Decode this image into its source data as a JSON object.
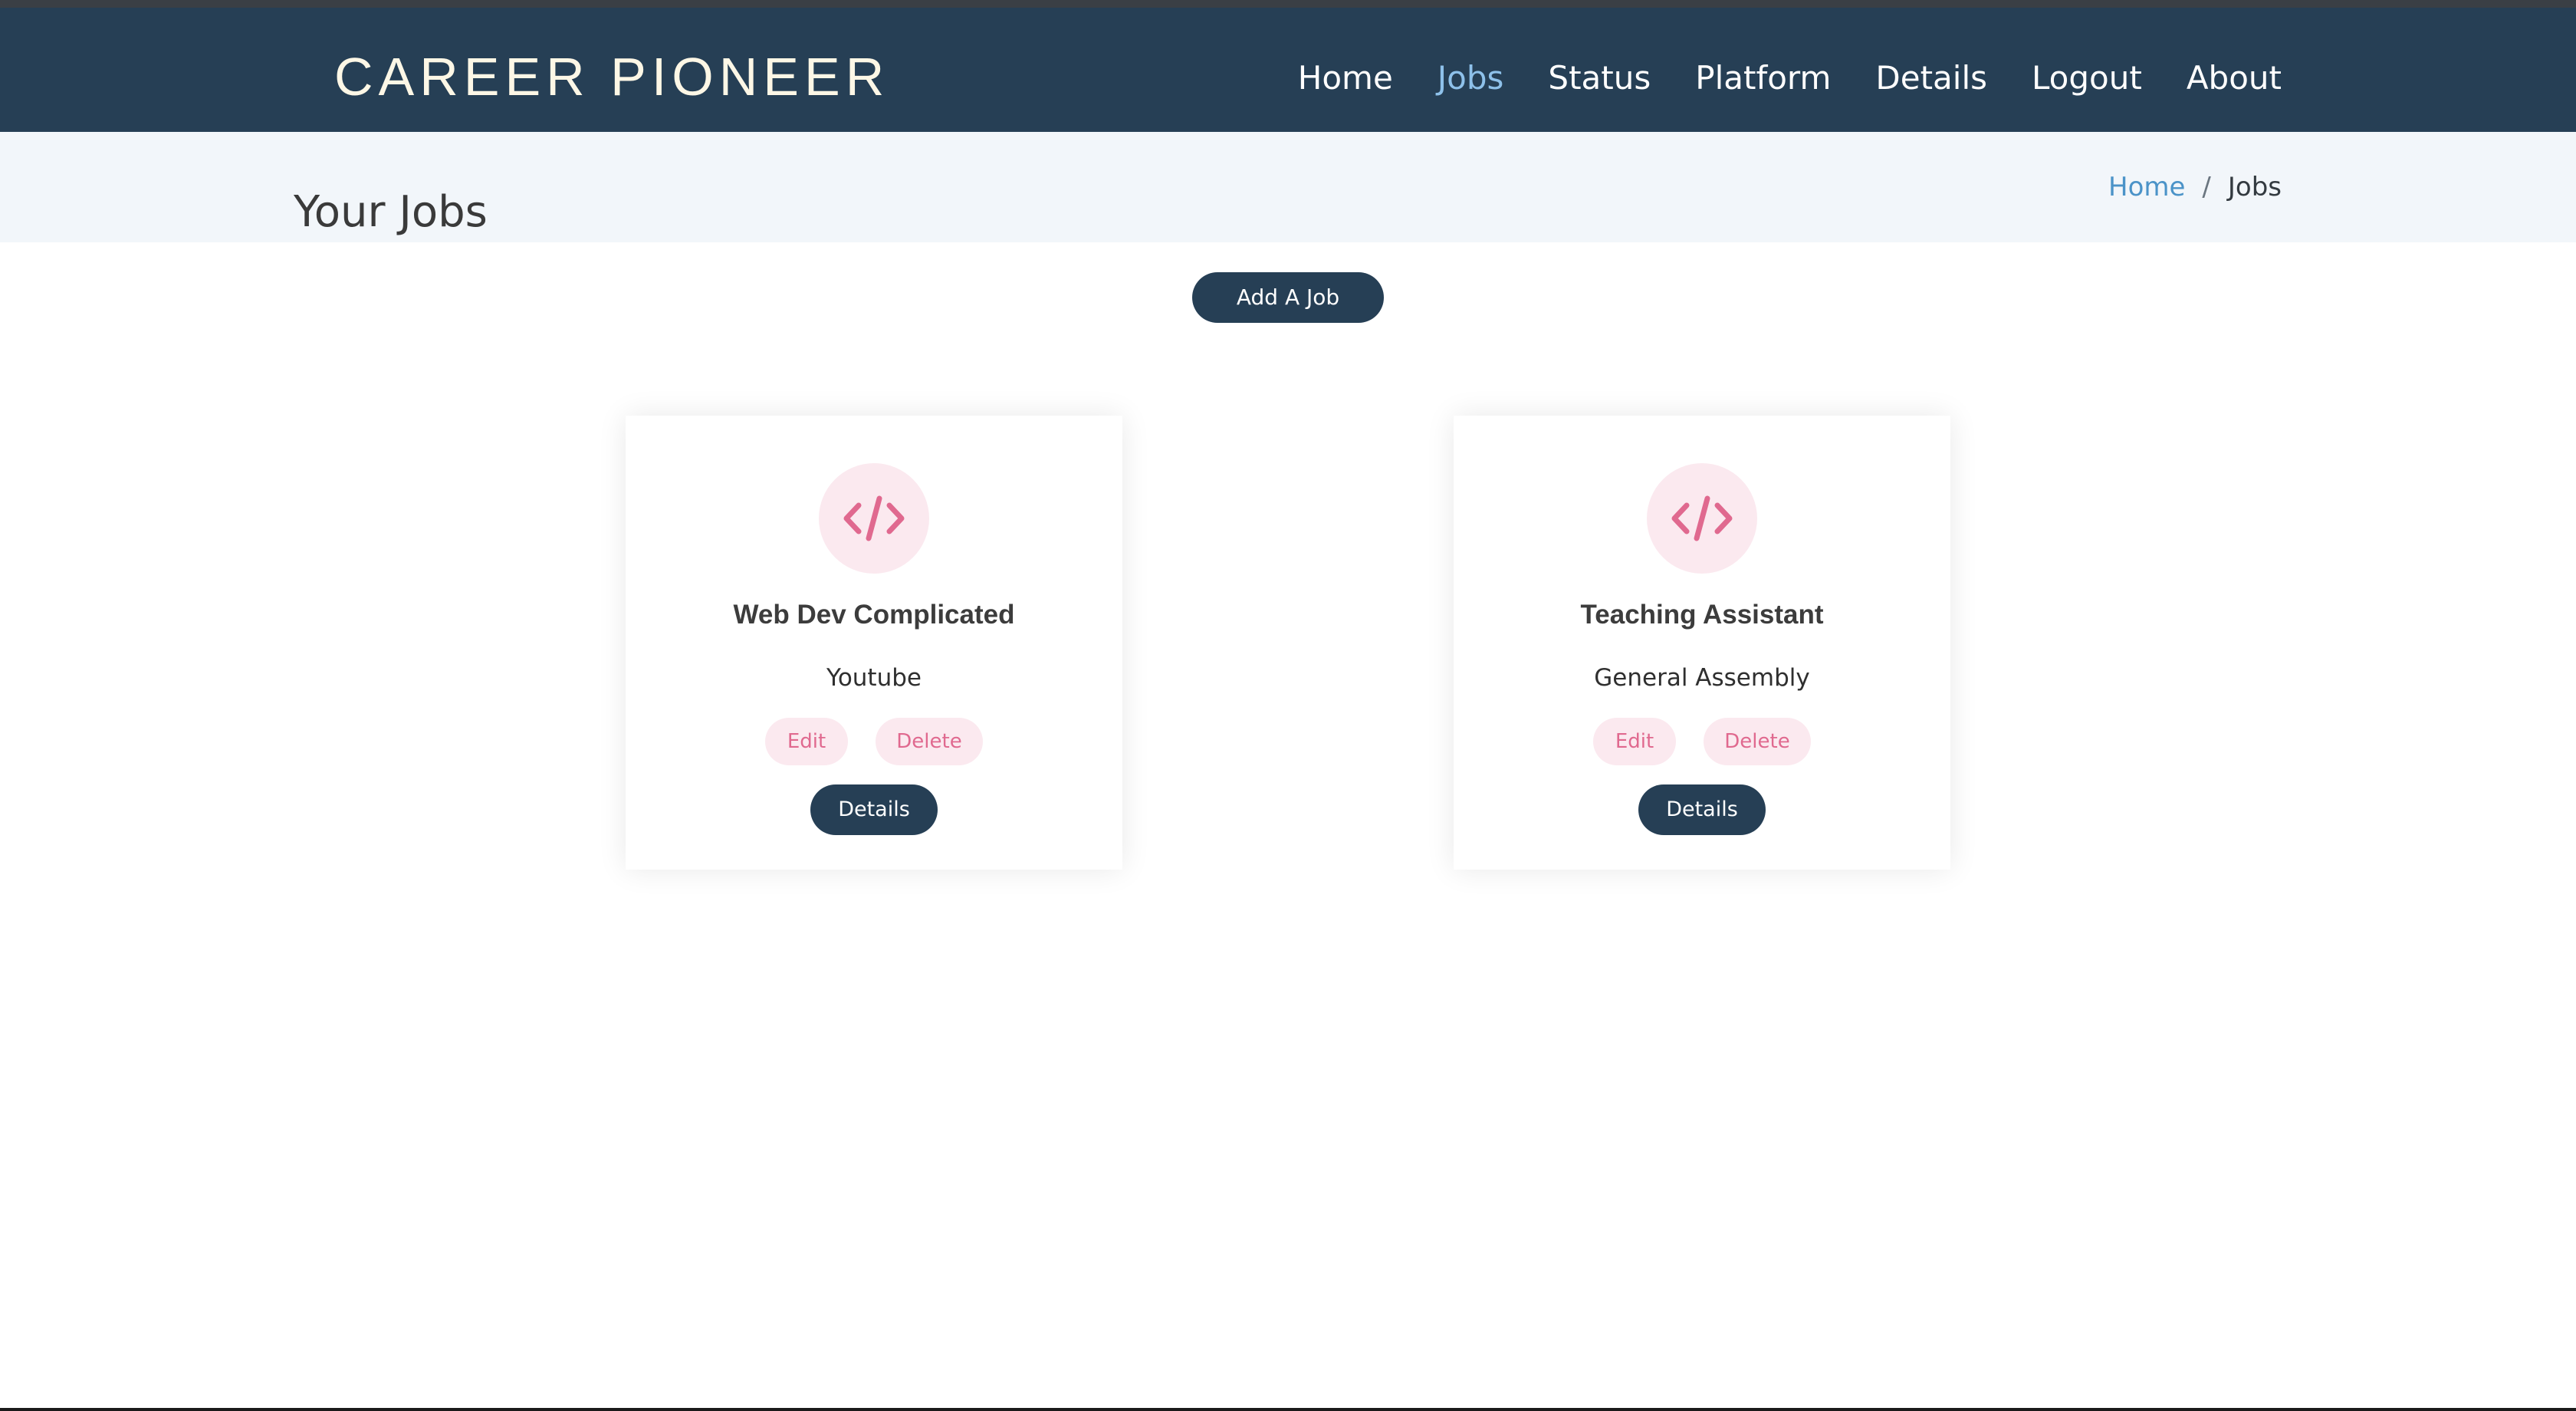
{
  "header": {
    "logo": "CAREER PIONEER",
    "nav": [
      {
        "label": "Home",
        "active": false
      },
      {
        "label": "Jobs",
        "active": true
      },
      {
        "label": "Status",
        "active": false
      },
      {
        "label": "Platform",
        "active": false
      },
      {
        "label": "Details",
        "active": false
      },
      {
        "label": "Logout",
        "active": false
      },
      {
        "label": "About",
        "active": false
      }
    ]
  },
  "title_bar": {
    "title": "Your Jobs",
    "breadcrumb": {
      "home": "Home",
      "separator": "/",
      "current": "Jobs"
    }
  },
  "actions": {
    "add_job": "Add A Job"
  },
  "jobs": [
    {
      "icon": "code-icon",
      "title": "Web Dev Complicated",
      "company": "Youtube",
      "edit": "Edit",
      "delete": "Delete",
      "details": "Details"
    },
    {
      "icon": "code-icon",
      "title": "Teaching Assistant",
      "company": "General Assembly",
      "edit": "Edit",
      "delete": "Delete",
      "details": "Details"
    }
  ],
  "colors": {
    "header_bg": "#263f55",
    "nav_active": "#8ec1ea",
    "title_bar_bg": "#f2f6fa",
    "accent_pink": "#e0698f",
    "pink_bg": "#fbe9ef",
    "button_dark": "#263f55",
    "breadcrumb_link": "#4b93c8"
  }
}
